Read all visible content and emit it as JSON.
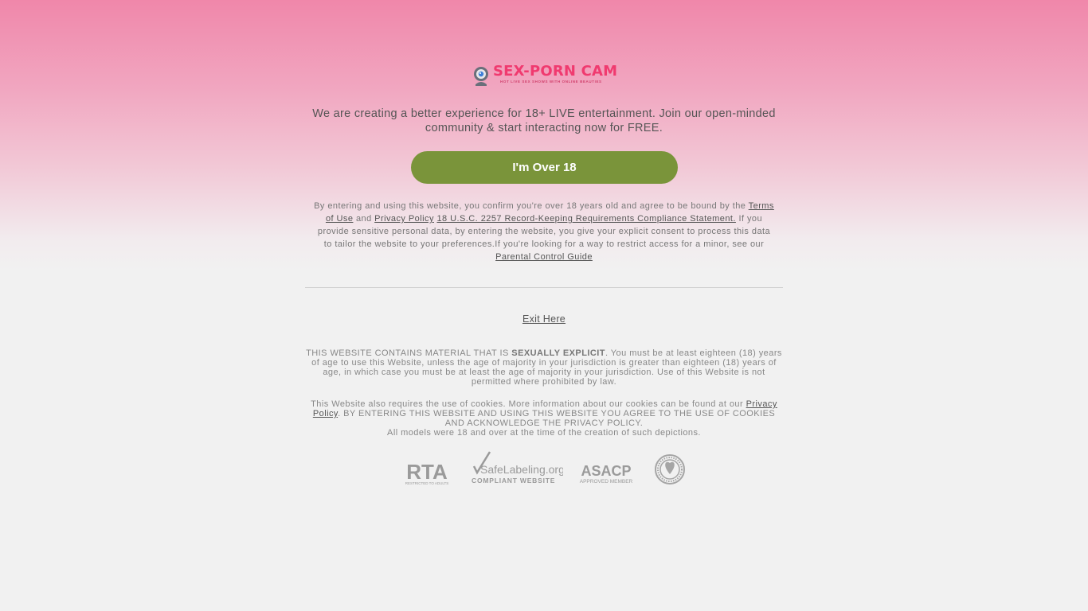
{
  "logo": {
    "name": "SEX-PORN CAM",
    "tagline": "HOT LIVE SEX SHOWS WITH ONLINE BEAUTIES"
  },
  "intro": "We are creating a better experience for 18+ LIVE entertainment. Join our open-minded community & start interacting now for FREE.",
  "over18_button": "I'm Over 18",
  "legal": {
    "line1": "By entering and using this website, you confirm you're over 18 years old and agree to be bound by the",
    "terms_link": "Terms of Use",
    "and": "and",
    "privacy_link": "Privacy Policy",
    "usc_link": "18 U.S.C. 2257 Record-Keeping Requirements Compliance Statement.",
    "line3": "If you provide sensitive personal data, by entering the website, you give your explicit consent to process this data to tailor the website to your preferences.If you're looking for a way to restrict access for a minor, see our",
    "parental_link": "Parental Control Guide"
  },
  "exit_link": "Exit Here",
  "warning": {
    "prefix": "THIS WEBSITE CONTAINS MATERIAL THAT IS",
    "bold": "SEXUALLY EXPLICIT",
    "suffix": ". You must be at least eighteen (18) years of age to use this Website, unless the age of majority in your jurisdiction is greater than eighteen (18) years of age, in which case you must be at least the age of majority in your jurisdiction. Use of this Website is not permitted where prohibited by law."
  },
  "cookie": {
    "prefix": "This Website also requires the use of cookies. More information about our cookies can be found at our",
    "privacy_link": "Privacy Policy",
    "suffix": ". BY ENTERING THIS WEBSITE AND USING THIS WEBSITE YOU AGREE TO THE USE OF COOKIES AND ACKNOWLEDGE THE PRIVACY POLICY."
  },
  "models_note": "All models were 18 and over at the time of the creation of such depictions.",
  "badges": {
    "rta": "RTA",
    "rta_sub": "RESTRICTED TO ADULTS",
    "safelabeling": "SafeLabeling.org",
    "safelabeling_sub": "COMPLIANT WEBSITE",
    "asacp": "ASACP",
    "asacp_sub": "APPROVED MEMBER"
  },
  "colors": {
    "brand": "#f03a6f",
    "button": "#7a943a",
    "background": "#f1f1f1"
  }
}
